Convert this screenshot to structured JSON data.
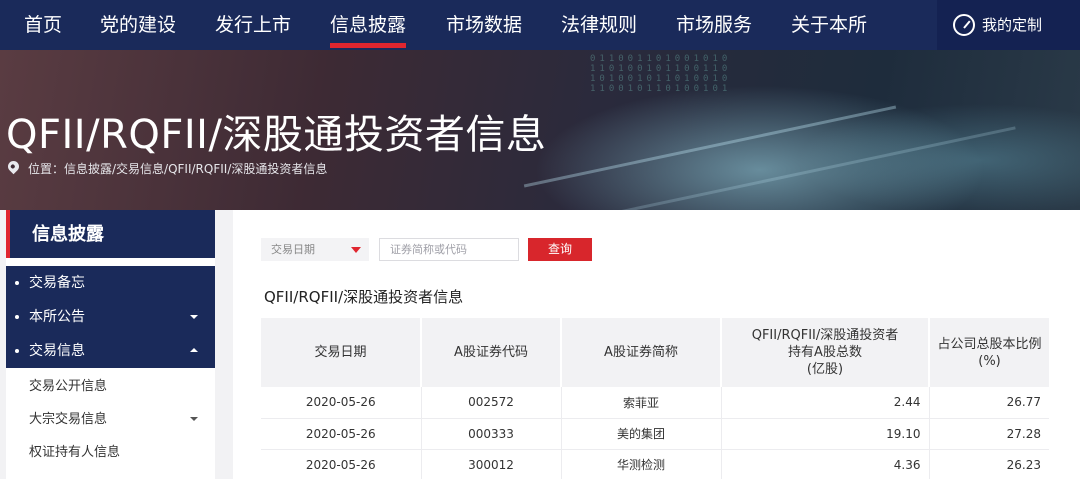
{
  "nav": {
    "items": [
      {
        "label": "首页",
        "active": false
      },
      {
        "label": "党的建设",
        "active": false
      },
      {
        "label": "发行上市",
        "active": false
      },
      {
        "label": "信息披露",
        "active": true
      },
      {
        "label": "市场数据",
        "active": false
      },
      {
        "label": "法律规则",
        "active": false
      },
      {
        "label": "市场服务",
        "active": false
      },
      {
        "label": "关于本所",
        "active": false
      }
    ],
    "custom_label": "我的定制",
    "custom_icon": "compass-icon"
  },
  "banner": {
    "title": "QFII/RQFII/深股通投资者信息",
    "breadcrumb": "位置：信息披露/交易信息/QFII/RQFII/深股通投资者信息"
  },
  "sidebar": {
    "header": "信息披露",
    "items": [
      {
        "label": "交易备忘",
        "expandable": false
      },
      {
        "label": "本所公告",
        "expandable": true,
        "expanded": false
      },
      {
        "label": "交易信息",
        "expandable": true,
        "expanded": true
      }
    ],
    "sub_items": [
      {
        "label": "交易公开信息",
        "expandable": false
      },
      {
        "label": "大宗交易信息",
        "expandable": true
      },
      {
        "label": "权证持有人信息",
        "expandable": false
      }
    ]
  },
  "filters": {
    "date_select": "交易日期",
    "search_placeholder": "证券简称或代码",
    "query_button": "查询"
  },
  "table": {
    "title": "QFII/RQFII/深股通投资者信息",
    "headers": [
      [
        "交易日期"
      ],
      [
        "A股证券代码"
      ],
      [
        "A股证券简称"
      ],
      [
        "QFII/RQFII/深股通投资者",
        "持有A股总数",
        "(亿股)"
      ],
      [
        "占公司总股本比例",
        "(%)"
      ]
    ],
    "rows": [
      [
        "2020-05-26",
        "002572",
        "索菲亚",
        "2.44",
        "26.77"
      ],
      [
        "2020-05-26",
        "000333",
        "美的集团",
        "19.10",
        "27.28"
      ],
      [
        "2020-05-26",
        "300012",
        "华测检测",
        "4.36",
        "26.23"
      ]
    ]
  },
  "colors": {
    "nav_bg": "#1a2a5a",
    "accent_red": "#e0262f",
    "button_red": "#d8262c"
  }
}
